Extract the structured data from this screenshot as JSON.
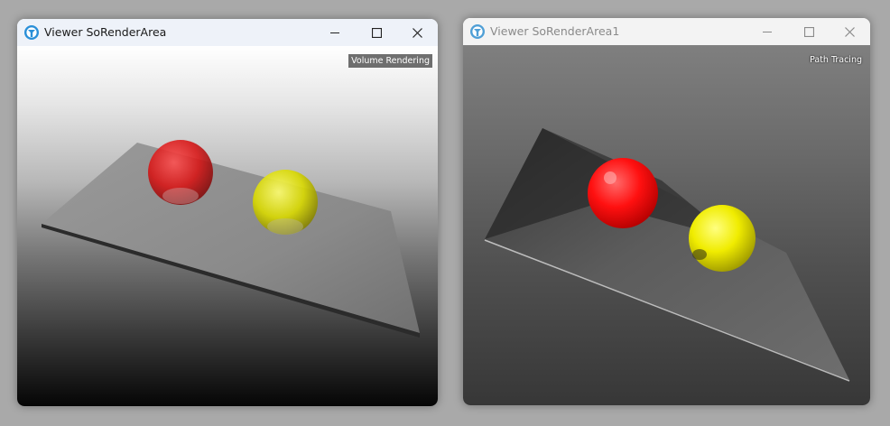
{
  "windows": [
    {
      "title": "Viewer SoRenderArea",
      "render_mode_label": "Volume Rendering",
      "caption_buttons": [
        "minimize-icon",
        "maximize-icon",
        "close-icon"
      ]
    },
    {
      "title": "Viewer SoRenderArea1",
      "render_mode_label": "Path Tracing",
      "caption_buttons": [
        "minimize-icon",
        "maximize-icon",
        "close-icon"
      ]
    }
  ],
  "scene": {
    "objects": [
      "grey plane",
      "red sphere",
      "yellow sphere"
    ],
    "colors": {
      "red_sphere": "#e01010",
      "yellow_sphere": "#e8e000",
      "plane": "#8c8c8c"
    }
  }
}
